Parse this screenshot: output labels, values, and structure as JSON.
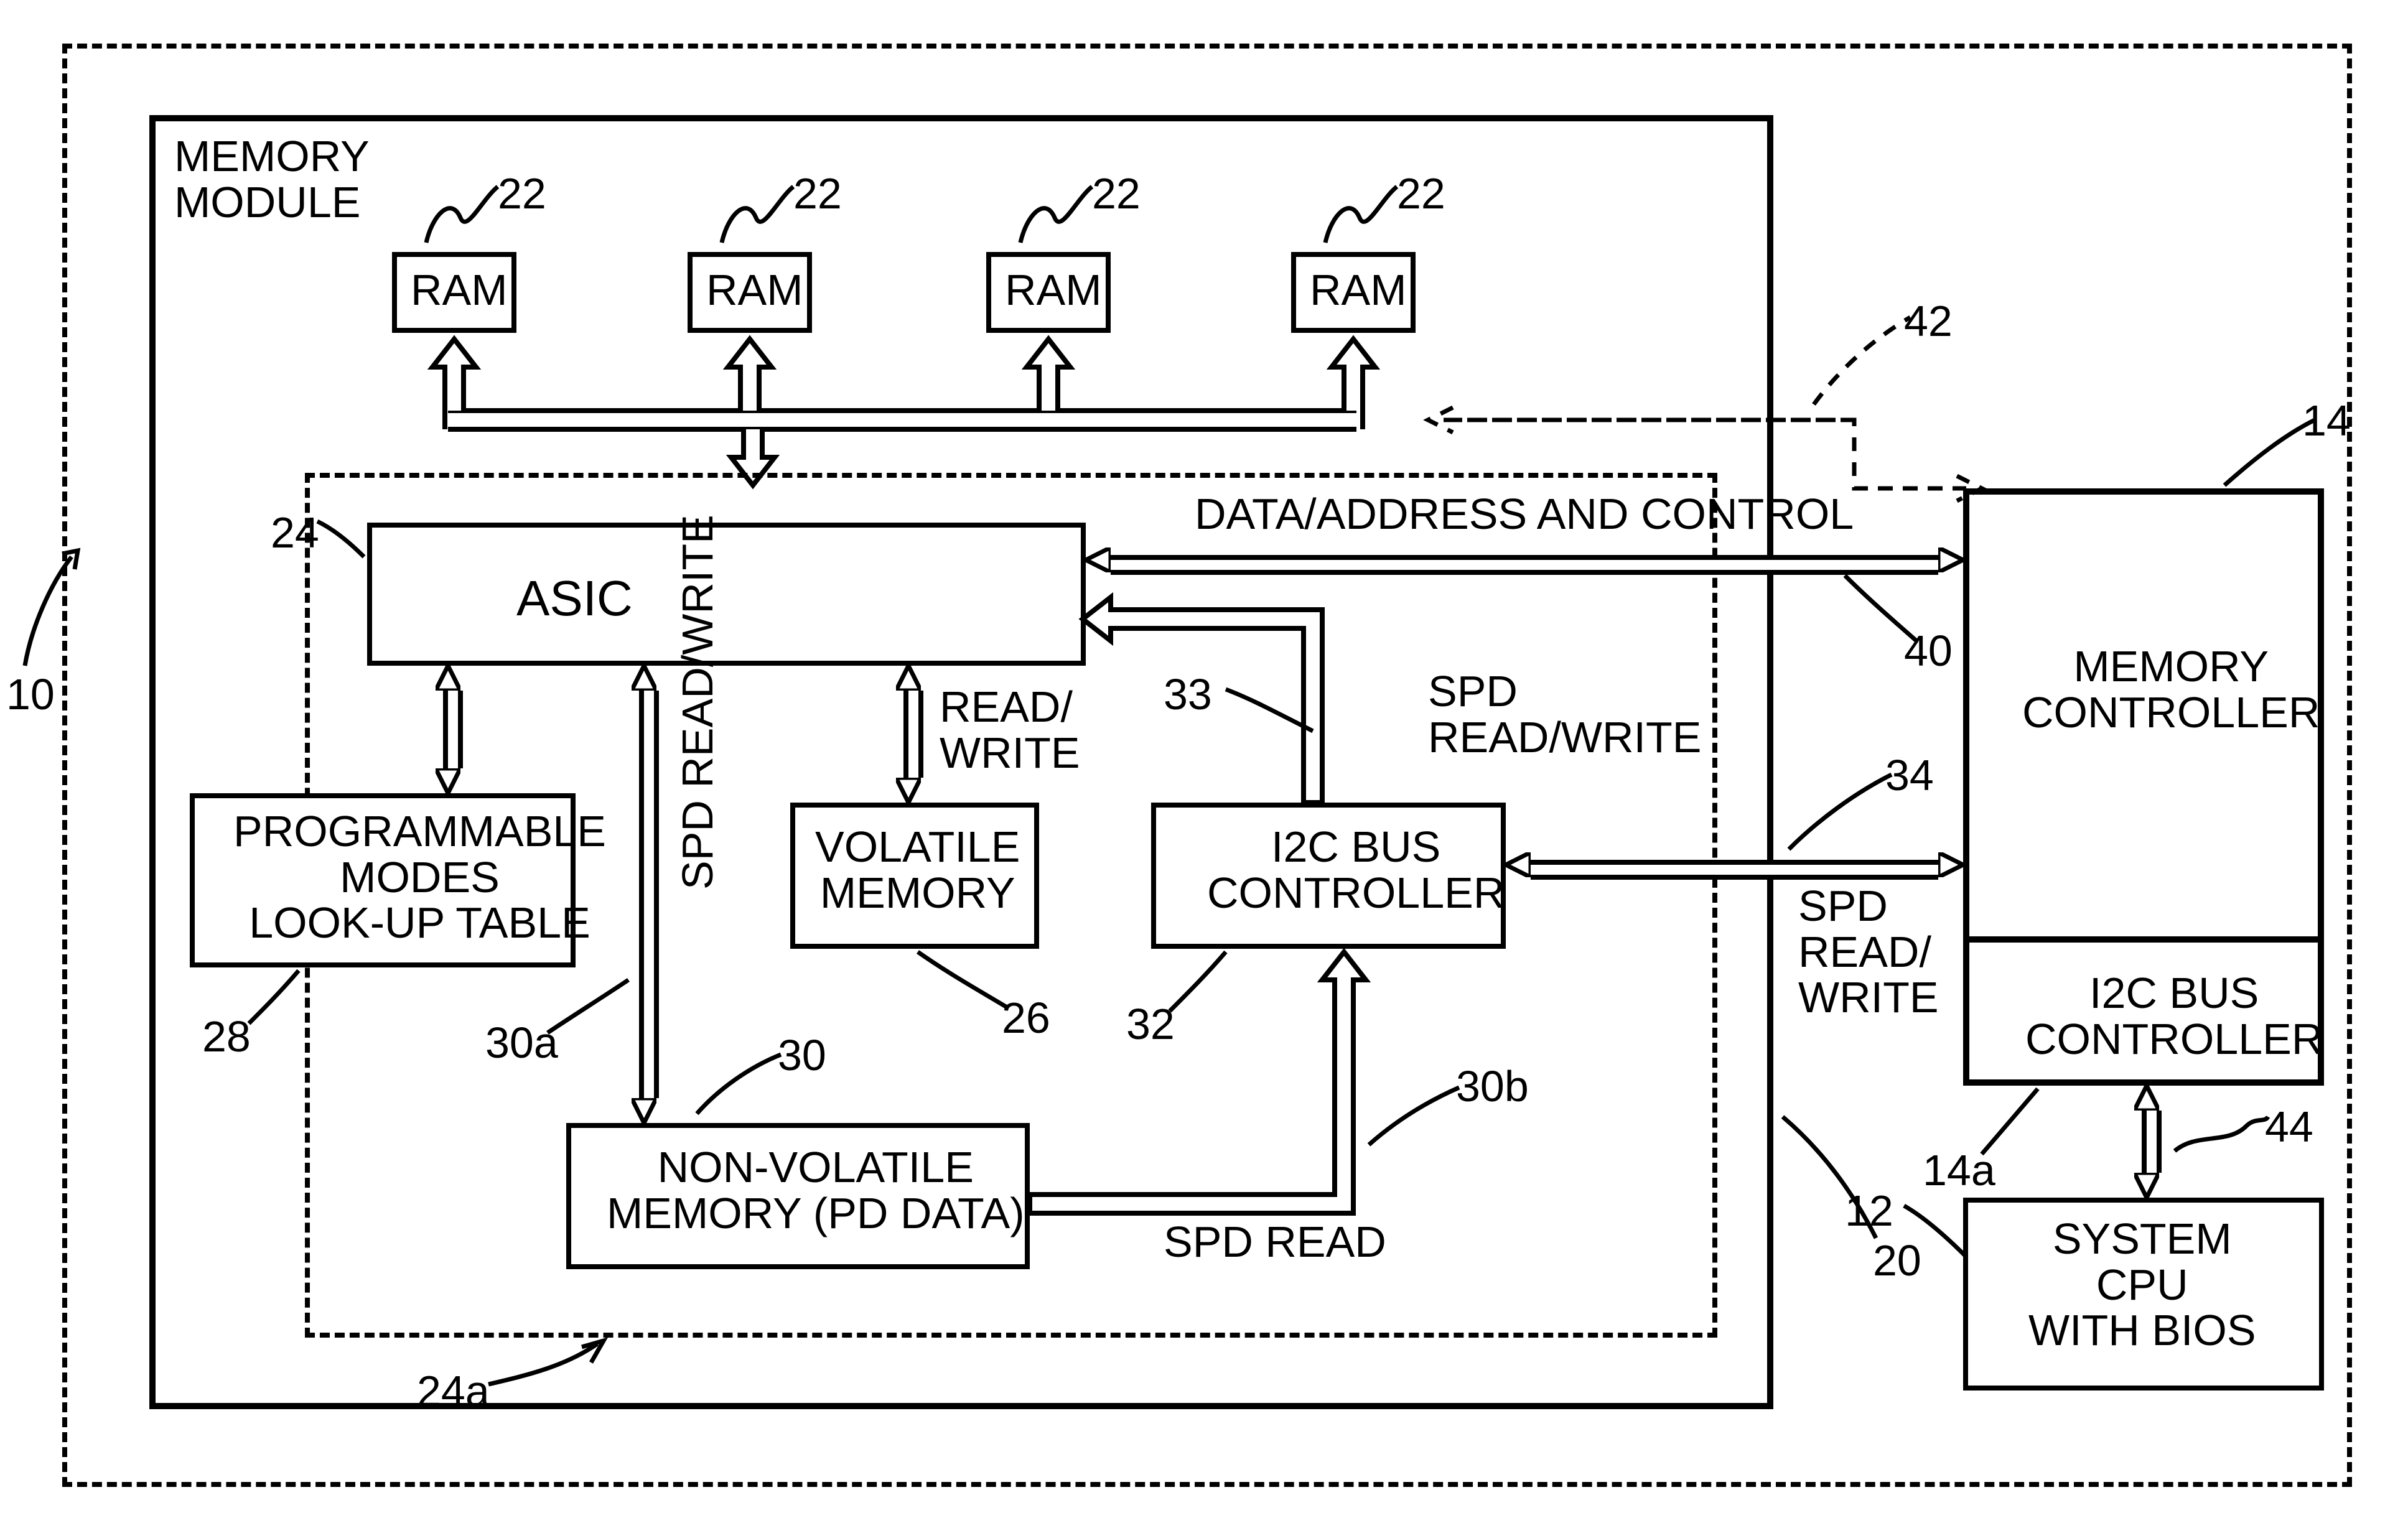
{
  "outer_ref": "10",
  "memory_module": {
    "title": "MEMORY\nMODULE",
    "ref": "20",
    "ram_label": "RAM",
    "ram_ref": "22",
    "asic": {
      "label": "ASIC",
      "ref": "24"
    },
    "asic_group_ref": "24a",
    "lut": {
      "label": "PROGRAMMABLE\nMODES\nLOOK-UP TABLE",
      "ref": "28"
    },
    "vm": {
      "label": "VOLATILE\nMEMORY",
      "ref": "26"
    },
    "nvm": {
      "label": "NON-VOLATILE\nMEMORY (PD DATA)",
      "ref": "30"
    },
    "i2c_bus": {
      "label": "I2C BUS\nCONTROLLER",
      "ref": "32"
    }
  },
  "right": {
    "mem_ctrl": {
      "label": "MEMORY\nCONTROLLER",
      "ref": "14"
    },
    "i2c_ctrl": {
      "label": "I2C BUS\nCONTROLLER",
      "ref": "14a"
    },
    "cpu": {
      "label": "SYSTEM\nCPU\nWITH BIOS",
      "ref": "12"
    }
  },
  "buses": {
    "data_addr": {
      "label": "DATA/ADDRESS AND CONTROL",
      "ref": "40"
    },
    "bus42_ref": "42",
    "spd_rw_internal": {
      "label": "SPD\nREAD/WRITE",
      "ref": "33"
    },
    "spd_rw_ext": {
      "label": "SPD\nREAD/\nWRITE",
      "ref": "34"
    },
    "asic_nvm": {
      "label": "SPD READ/WRITE",
      "ref": "30a"
    },
    "nvm_i2c": {
      "label": "SPD READ",
      "ref": "30b"
    },
    "asic_vm": {
      "label": "READ/\nWRITE"
    },
    "cpu_link_ref": "44"
  }
}
